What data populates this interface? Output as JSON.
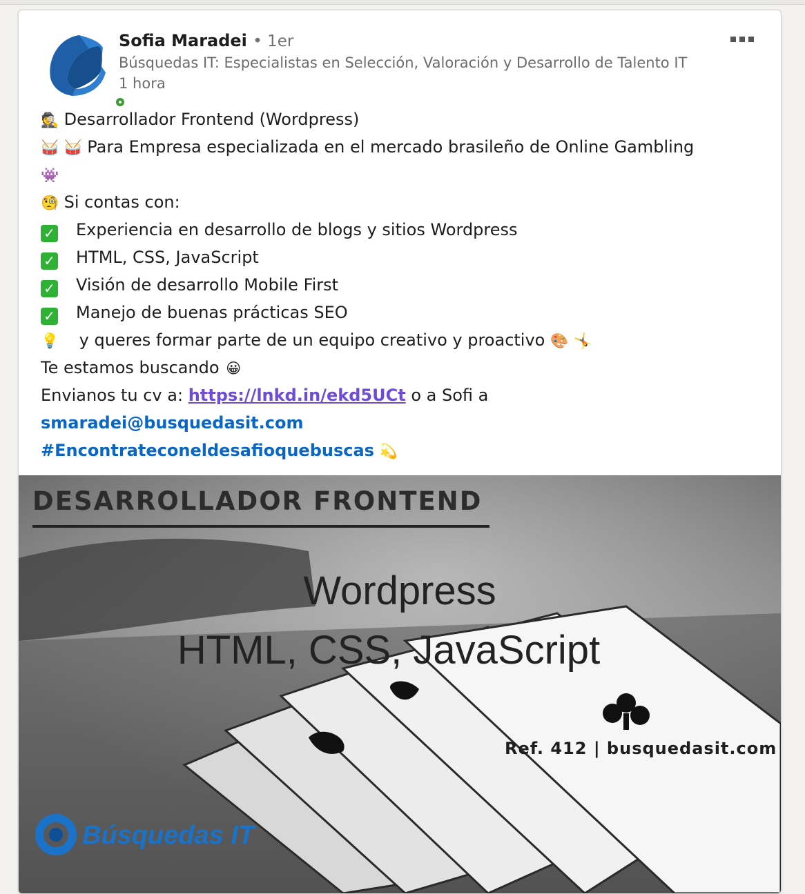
{
  "post": {
    "actor": {
      "name": "Sofia Maradei",
      "degree": "• 1er",
      "description": "Búsquedas IT: Especialistas en Selección, Valoración y Desarrollo de Talento IT",
      "time": "1 hora"
    },
    "lines": {
      "l1_emoji": "🕵",
      "l1_text": "Desarrollador Frontend (Wordpress)",
      "l2_emoji_a": "🥁",
      "l2_emoji_b": "🥁",
      "l2_text": "Para Empresa especializada en el mercado brasileño de Online Gambling",
      "l3_emoji": "👾",
      "l4_emoji": "🧐",
      "l4_text": "Si contas con:",
      "check_mark": "✓",
      "b1": "Experiencia en desarrollo de blogs y sitios Wordpress",
      "b2": "HTML, CSS, JavaScript",
      "b3": "Visión de desarrollo Mobile First",
      "b4": "Manejo de buenas prácticas SEO",
      "l9_emoji": "💡",
      "l9_text": "y queres formar parte de un equipo creativo y proactivo",
      "l9_emoji_end_a": "🎨",
      "l9_emoji_end_b": "🤸",
      "l10_text": "Te estamos buscando",
      "l10_emoji": "😀",
      "l11_prefix": "Envianos tu cv a:",
      "l11_link": "https://lnkd.in/ekd5UCt",
      "l11_suffix": "o a Sofi a",
      "email": "smaradei@busquedasit.com",
      "hashtag": "#Encontrateconeldesafioquebuscas",
      "hashtag_emoji": "💫"
    },
    "image": {
      "title": "DESARROLLADOR FRONTEND",
      "line1": "Wordpress",
      "line2": "HTML, CSS, JavaScript",
      "ref": "Ref. 412 | busquedasit.com",
      "logo_text": "Búsquedas IT"
    }
  },
  "colors": {
    "brand_blue": "#0a66c2",
    "link_purple": "#6e4cd6",
    "presence_green": "#3c9a35",
    "check_green": "#2eb135"
  }
}
